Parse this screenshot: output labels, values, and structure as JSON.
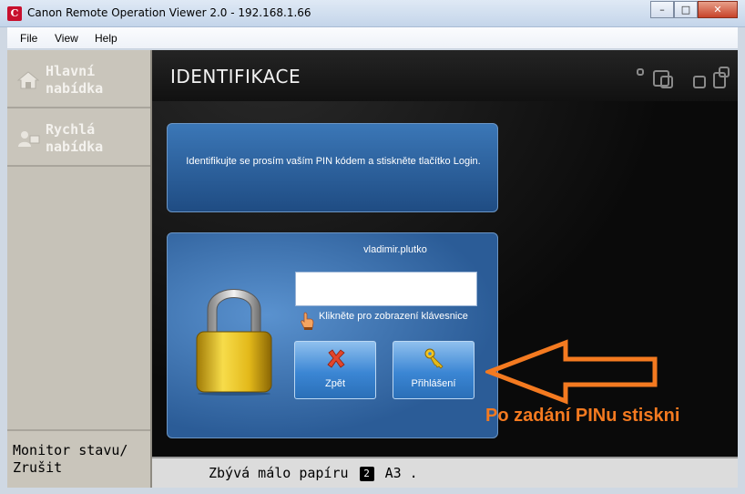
{
  "window": {
    "title": "Canon Remote Operation Viewer 2.0 - 192.168.1.66",
    "app_icon_glyph": "C",
    "buttons": {
      "minimize": "–",
      "maximize": "□",
      "close": "✕"
    }
  },
  "menubar": {
    "items": [
      "File",
      "View",
      "Help"
    ]
  },
  "sidebar": {
    "items": [
      {
        "label": "Hlavní\nnabídka",
        "icon": "home-icon"
      },
      {
        "label": "Rychlá\nnabídka",
        "icon": "quick-menu-icon"
      }
    ],
    "bottom": {
      "label": "Monitor stavu/\nZrušit"
    }
  },
  "main": {
    "title": "IDENTIFIKACE",
    "message": "Identifikujte se prosím vaším PIN kódem a stiskněte tlačítko Login.",
    "login": {
      "username": "vladimir.plutko",
      "pin_value": "",
      "keyboard_hint": "Klikněte pro zobrazení klávesnice",
      "back_label": "Zpět",
      "login_label": "Přihlášení"
    }
  },
  "annotation": {
    "text": "Po zadání PINu stiskni",
    "color": "#f47a20"
  },
  "status": {
    "prefix": "Zbývá málo papíru",
    "badge": "2",
    "suffix": "A3 ."
  },
  "colors": {
    "panel_blue": "#2b5c97",
    "button_blue": "#3b86d4",
    "accent_orange": "#f47a20"
  }
}
